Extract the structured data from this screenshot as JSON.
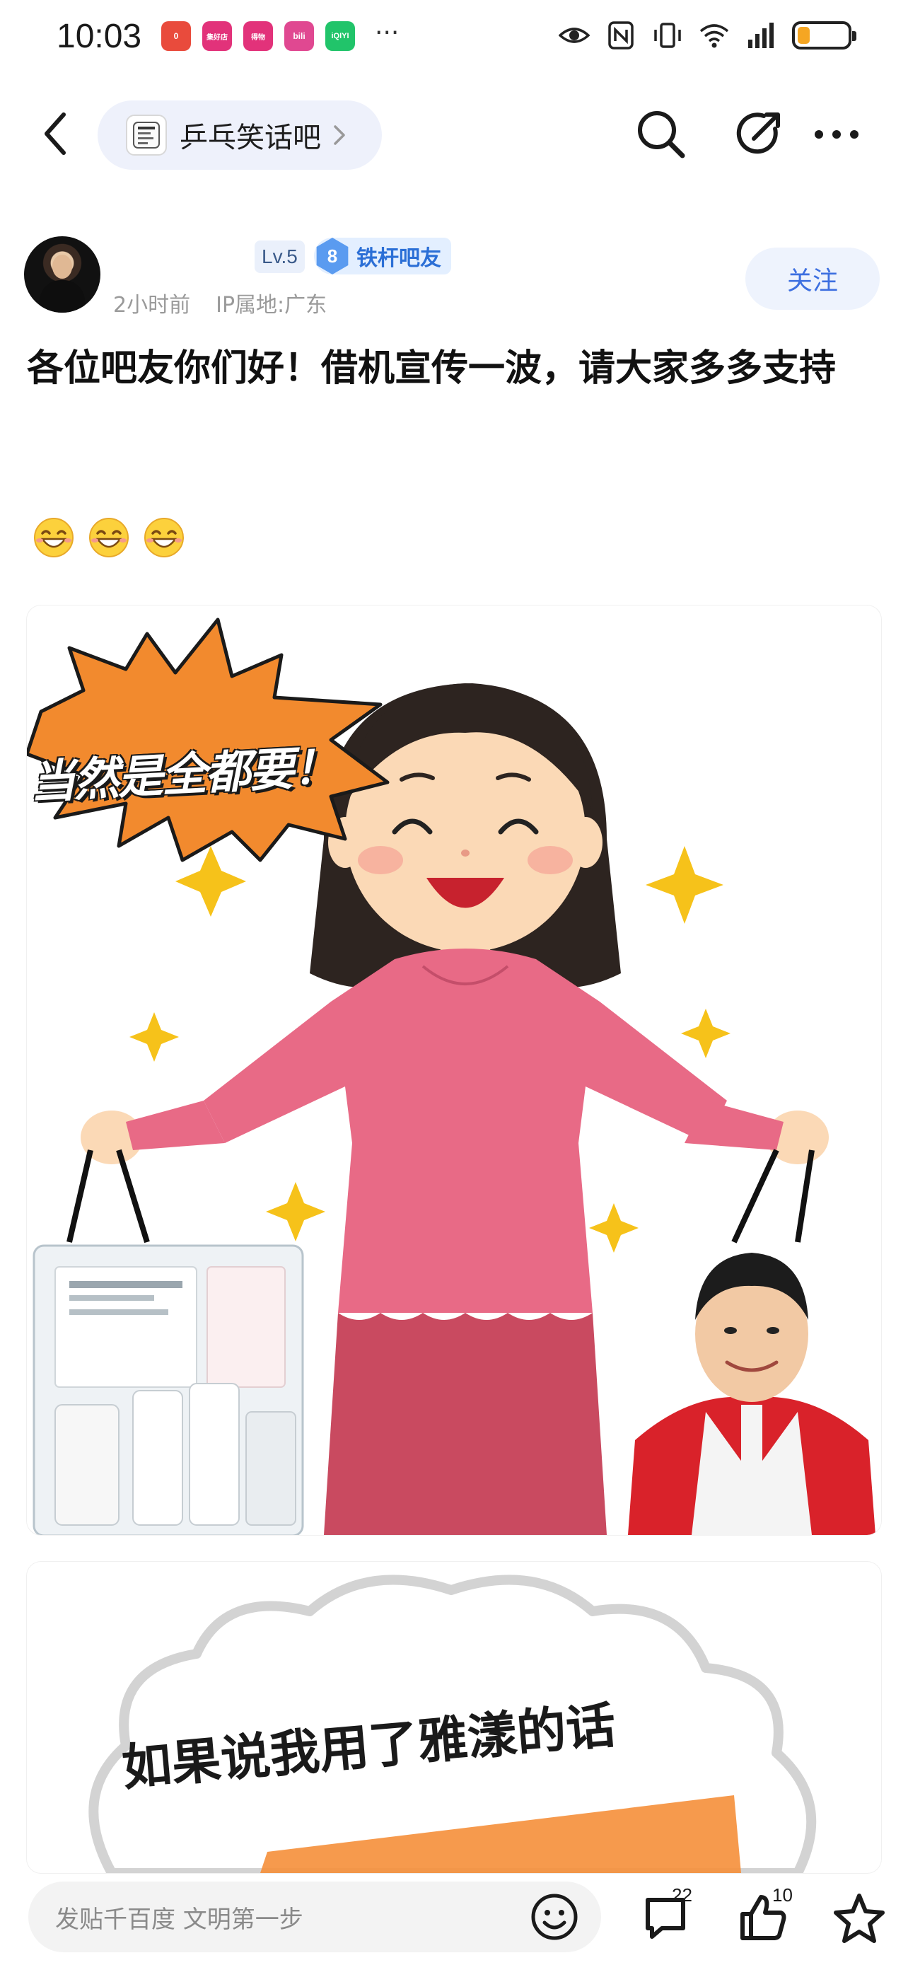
{
  "status_bar": {
    "time": "10:03",
    "apps": [
      {
        "name": "app-red",
        "label": "0",
        "color": "#e94b3c"
      },
      {
        "name": "app-magenta-1",
        "label": "集好店",
        "color": "#e2327a"
      },
      {
        "name": "app-magenta-2",
        "label": "得物",
        "color": "#e2327a"
      },
      {
        "name": "app-pink",
        "label": "bili",
        "color": "#e04891"
      },
      {
        "name": "app-green",
        "label": "iQIYI",
        "color": "#21c46a"
      }
    ],
    "more": "···",
    "battery_level": 0.25,
    "battery_color": "#f5a623"
  },
  "nav": {
    "forum_name": "乒乓笑话吧"
  },
  "post": {
    "level": "Lv.5",
    "title_badge_number": "8",
    "title_badge": "铁杆吧友",
    "time_ago": "2小时前",
    "ip_location": "IP属地:广东",
    "follow_label": "关注",
    "title": "各位吧友你们好！借机宣传一波，请大家多多支持",
    "emoji_count": 3,
    "image1": {
      "speech_text": "当然是全都要！"
    },
    "image2": {
      "cloud_text": "如果说我用了雅漾的话"
    }
  },
  "bottom_bar": {
    "placeholder": "发贴千百度 文明第一步",
    "comment_count": "22",
    "like_count": "10"
  },
  "colors": {
    "accent_blue": "#3d6fe0",
    "follow_bg": "#eef3fd",
    "burst_orange": "#f28a2e",
    "shirt_pink": "#e86a86"
  }
}
